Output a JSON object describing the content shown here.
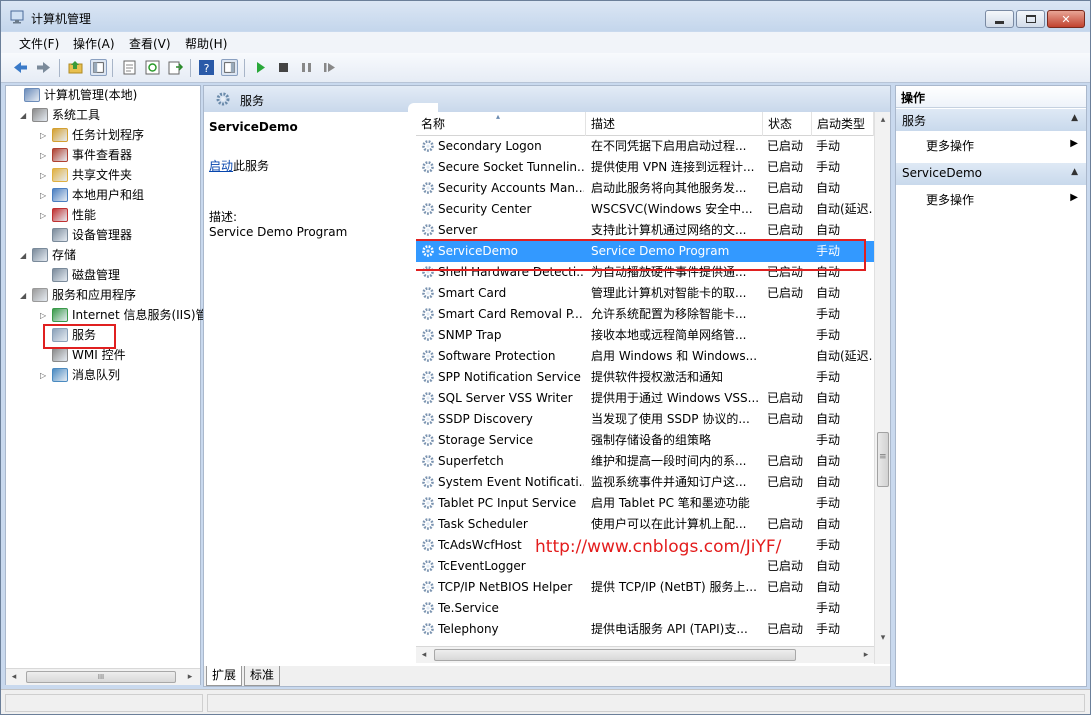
{
  "window": {
    "title": "计算机管理",
    "min_btn": "▭",
    "max_btn": "▢",
    "close_btn": "✕"
  },
  "menu": [
    "文件(F)",
    "操作(A)",
    "查看(V)",
    "帮助(H)"
  ],
  "tree": [
    {
      "label": "计算机管理(本地)",
      "level": 0,
      "expander": "",
      "icon": "computer-management-icon",
      "icon_color": "#6b8cba"
    },
    {
      "label": "系统工具",
      "level": 1,
      "expander": "◢",
      "icon": "system-tools-icon",
      "icon_color": "#8a8a8a"
    },
    {
      "label": "任务计划程序",
      "level": 2,
      "expander": "▷",
      "icon": "task-scheduler-icon",
      "icon_color": "#d4a030"
    },
    {
      "label": "事件查看器",
      "level": 2,
      "expander": "▷",
      "icon": "event-viewer-icon",
      "icon_color": "#b04030"
    },
    {
      "label": "共享文件夹",
      "level": 2,
      "expander": "▷",
      "icon": "shared-folders-icon",
      "icon_color": "#e0b040"
    },
    {
      "label": "本地用户和组",
      "level": 2,
      "expander": "▷",
      "icon": "local-users-icon",
      "icon_color": "#4a7ec0"
    },
    {
      "label": "性能",
      "level": 2,
      "expander": "▷",
      "icon": "performance-icon",
      "icon_color": "#c03030"
    },
    {
      "label": "设备管理器",
      "level": 2,
      "expander": "",
      "icon": "device-manager-icon",
      "icon_color": "#7a8a9a"
    },
    {
      "label": "存储",
      "level": 1,
      "expander": "◢",
      "icon": "storage-icon",
      "icon_color": "#7a8a9a"
    },
    {
      "label": "磁盘管理",
      "level": 2,
      "expander": "",
      "icon": "disk-management-icon",
      "icon_color": "#7a8a9a"
    },
    {
      "label": "服务和应用程序",
      "level": 1,
      "expander": "◢",
      "icon": "services-apps-icon",
      "icon_color": "#9a9a9a"
    },
    {
      "label": "Internet 信息服务(IIS)管",
      "level": 2,
      "expander": "▷",
      "icon": "iis-icon",
      "icon_color": "#3a9a4a"
    },
    {
      "label": "服务",
      "level": 2,
      "expander": "",
      "icon": "services-gear-icon",
      "icon_color": "#8aa0b8"
    },
    {
      "label": "WMI 控件",
      "level": 2,
      "expander": "",
      "icon": "wmi-control-icon",
      "icon_color": "#8a8a8a"
    },
    {
      "label": "消息队列",
      "level": 2,
      "expander": "▷",
      "icon": "message-queue-icon",
      "icon_color": "#4a8ac0"
    }
  ],
  "tree_scroll": {
    "left": "◂",
    "right": "▸",
    "grip": "III"
  },
  "services_panel": {
    "header": "服务"
  },
  "detail": {
    "name": "ServiceDemo",
    "start_link": "启动",
    "start_suffix": "此服务",
    "desc_label": "描述:",
    "desc": "Service Demo Program"
  },
  "columns": [
    "名称",
    "描述",
    "状态",
    "启动类型"
  ],
  "services": [
    {
      "name": "Secondary Logon",
      "desc": "在不同凭据下启用启动过程...",
      "status": "已启动",
      "startup": "手动"
    },
    {
      "name": "Secure Socket Tunnelin...",
      "desc": "提供使用 VPN 连接到远程计...",
      "status": "已启动",
      "startup": "手动"
    },
    {
      "name": "Security Accounts Man...",
      "desc": "启动此服务将向其他服务发...",
      "status": "已启动",
      "startup": "自动"
    },
    {
      "name": "Security Center",
      "desc": "WSCSVC(Windows 安全中...",
      "status": "已启动",
      "startup": "自动(延迟..."
    },
    {
      "name": "Server",
      "desc": "支持此计算机通过网络的文...",
      "status": "已启动",
      "startup": "自动"
    },
    {
      "name": "ServiceDemo",
      "desc": "Service Demo Program",
      "status": "",
      "startup": "手动"
    },
    {
      "name": "Shell Hardware Detecti...",
      "desc": "为自动播放硬件事件提供通...",
      "status": "已启动",
      "startup": "自动"
    },
    {
      "name": "Smart Card",
      "desc": "管理此计算机对智能卡的取...",
      "status": "已启动",
      "startup": "自动"
    },
    {
      "name": "Smart Card Removal P...",
      "desc": "允许系统配置为移除智能卡...",
      "status": "",
      "startup": "手动"
    },
    {
      "name": "SNMP Trap",
      "desc": "接收本地或远程简单网络管...",
      "status": "",
      "startup": "手动"
    },
    {
      "name": "Software Protection",
      "desc": "启用 Windows 和 Windows...",
      "status": "",
      "startup": "自动(延迟..."
    },
    {
      "name": "SPP Notification Service",
      "desc": "提供软件授权激活和通知",
      "status": "",
      "startup": "手动"
    },
    {
      "name": "SQL Server VSS Writer",
      "desc": "提供用于通过 Windows VSS...",
      "status": "已启动",
      "startup": "自动"
    },
    {
      "name": "SSDP Discovery",
      "desc": "当发现了使用 SSDP 协议的...",
      "status": "已启动",
      "startup": "自动"
    },
    {
      "name": "Storage Service",
      "desc": "强制存储设备的组策略",
      "status": "",
      "startup": "手动"
    },
    {
      "name": "Superfetch",
      "desc": "维护和提高一段时间内的系...",
      "status": "已启动",
      "startup": "自动"
    },
    {
      "name": "System Event Notificati...",
      "desc": "监视系统事件并通知订户这...",
      "status": "已启动",
      "startup": "自动"
    },
    {
      "name": "Tablet PC Input Service",
      "desc": "启用 Tablet PC 笔和墨迹功能",
      "status": "",
      "startup": "手动"
    },
    {
      "name": "Task Scheduler",
      "desc": "使用户可以在此计算机上配...",
      "status": "已启动",
      "startup": "自动"
    },
    {
      "name": "TcAdsWcfHost",
      "desc": "",
      "status": "",
      "startup": "手动"
    },
    {
      "name": "TcEventLogger",
      "desc": "",
      "status": "已启动",
      "startup": "自动"
    },
    {
      "name": "TCP/IP NetBIOS Helper",
      "desc": "提供 TCP/IP (NetBT) 服务上...",
      "status": "已启动",
      "startup": "自动"
    },
    {
      "name": "Te.Service",
      "desc": "",
      "status": "",
      "startup": "手动"
    },
    {
      "name": "Telephony",
      "desc": "提供电话服务 API (TAPI)支...",
      "status": "已启动",
      "startup": "手动"
    }
  ],
  "selected_service": "ServiceDemo",
  "list_scroll": {
    "up": "▴",
    "down": "▾",
    "left": "◂",
    "right": "▸",
    "grip": "≡"
  },
  "tabs": [
    "扩展",
    "标准"
  ],
  "actions": {
    "title": "操作",
    "sections": [
      {
        "title": "服务",
        "items": [
          "更多操作"
        ]
      },
      {
        "title": "ServiceDemo",
        "items": [
          "更多操作"
        ]
      }
    ],
    "collapse_glyph": "▲",
    "more_glyph": "▶"
  },
  "watermark": "http://www.cnblogs.com/JiYF/",
  "colors": {
    "selection": "#3399ff",
    "highlight_box": "#e02020",
    "link": "#0645ad"
  }
}
